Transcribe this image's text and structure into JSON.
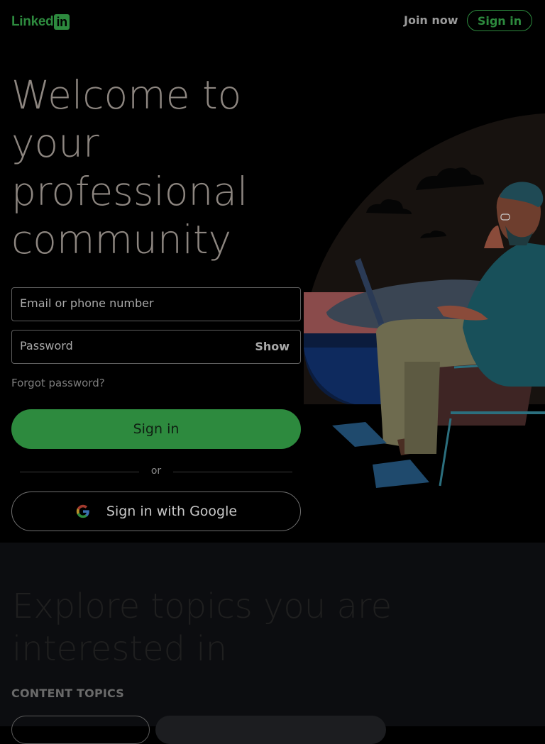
{
  "header": {
    "logo_text": "Linked",
    "logo_box_text": "in",
    "join_now": "Join now",
    "sign_in": "Sign in"
  },
  "hero": {
    "headline": "Welcome to your professional community",
    "email_placeholder": "Email or phone number",
    "password_placeholder": "Password",
    "show_label": "Show",
    "forgot_password": "Forgot password?",
    "sign_in_button": "Sign in",
    "divider_text": "or",
    "google_button": "Sign in with Google"
  },
  "explore": {
    "heading": "Explore topics you are interested in",
    "section_label": "CONTENT TOPICS"
  },
  "colors": {
    "brand": "#2d8a3e",
    "background": "#000000",
    "explore_bg": "#0c0d10"
  }
}
